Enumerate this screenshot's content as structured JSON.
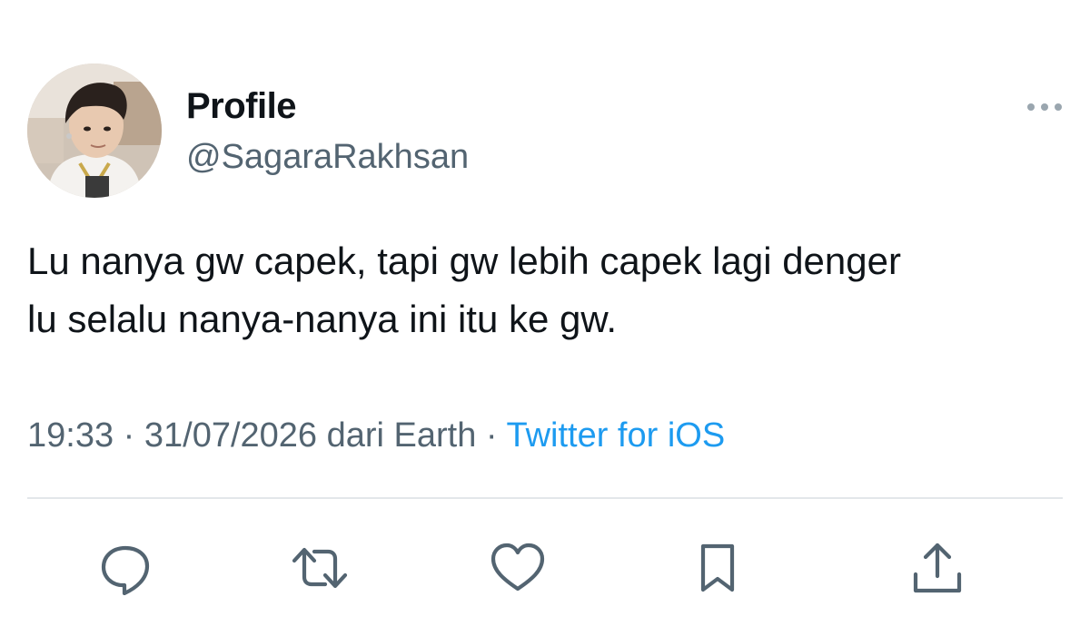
{
  "tweet": {
    "author": {
      "display_name": "Profile",
      "handle": "@SagaraRakhsan",
      "avatar_icon": "user-avatar-photo"
    },
    "text_lines": [
      "Lu nanya gw capek, tapi gw lebih capek lagi denger",
      "lu selalu nanya-nanya ini itu ke gw."
    ],
    "meta": {
      "time": "19:33",
      "separator": " · ",
      "date_location": "31/07/2026 dari Earth",
      "source": "Twitter for iOS"
    },
    "more_icon": "more-options-icon"
  },
  "actions": [
    {
      "name": "reply",
      "icon": "reply-icon"
    },
    {
      "name": "retweet",
      "icon": "retweet-icon"
    },
    {
      "name": "like",
      "icon": "heart-icon"
    },
    {
      "name": "bookmark",
      "icon": "bookmark-icon"
    },
    {
      "name": "share",
      "icon": "share-icon"
    }
  ],
  "colors": {
    "text": "#0f1419",
    "secondary": "#536471",
    "link": "#1d9bf0",
    "divider": "#e3e7ea"
  }
}
